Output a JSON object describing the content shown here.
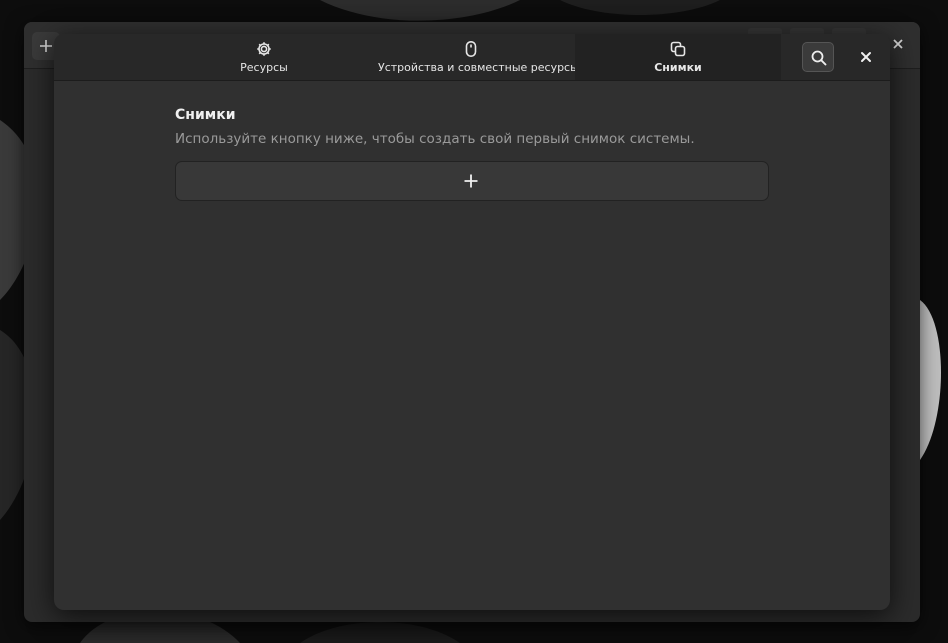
{
  "background_window": {
    "add_icon": "plus-icon",
    "close_icon": "close-icon"
  },
  "dialog": {
    "tabs": [
      {
        "label": "Ресурсы",
        "icon": "gear-icon",
        "active": false
      },
      {
        "label": "Устройства и совместные ресурсы",
        "icon": "mouse-icon",
        "active": false
      },
      {
        "label": "Снимки",
        "icon": "snapshots-icon",
        "active": true
      }
    ],
    "search_icon": "search-icon",
    "close_icon": "close-icon"
  },
  "snapshots": {
    "title": "Снимки",
    "description": "Используйте кнопку ниже, чтобы создать свой первый снимок системы.",
    "add_icon": "plus-icon"
  },
  "colors": {
    "dialog_bg": "#303030",
    "header_bg": "#282828",
    "active_tab_bg": "#222222",
    "text_primary": "#f0f0f0",
    "text_secondary": "#9a9a9a"
  }
}
